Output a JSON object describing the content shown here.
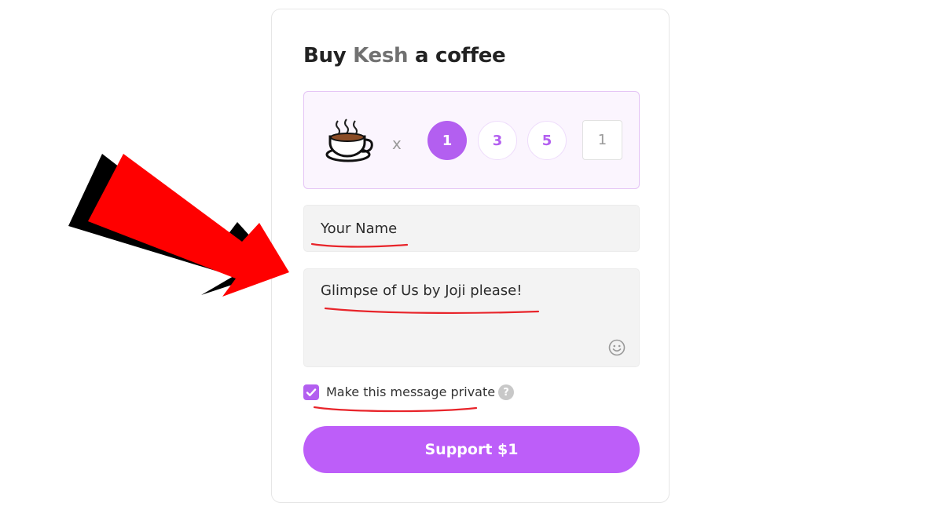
{
  "card": {
    "title_prefix": "Buy ",
    "title_name": "Kesh",
    "title_suffix": " a coffee"
  },
  "quantity": {
    "icon": "coffee-cup-icon",
    "multiplier": "x",
    "options": [
      "1",
      "3",
      "5"
    ],
    "selected": "1",
    "custom_value": "1"
  },
  "form": {
    "name_value": "Your Name",
    "message_value": "Glimpse of Us by Joji please!",
    "private_label": "Make this message private",
    "private_checked": true,
    "help_glyph": "?"
  },
  "support_button": {
    "label": "Support $1"
  },
  "colors": {
    "accent": "#bd5ef9",
    "annotation_arrow": "#ff0000",
    "underline": "#e8242a"
  }
}
